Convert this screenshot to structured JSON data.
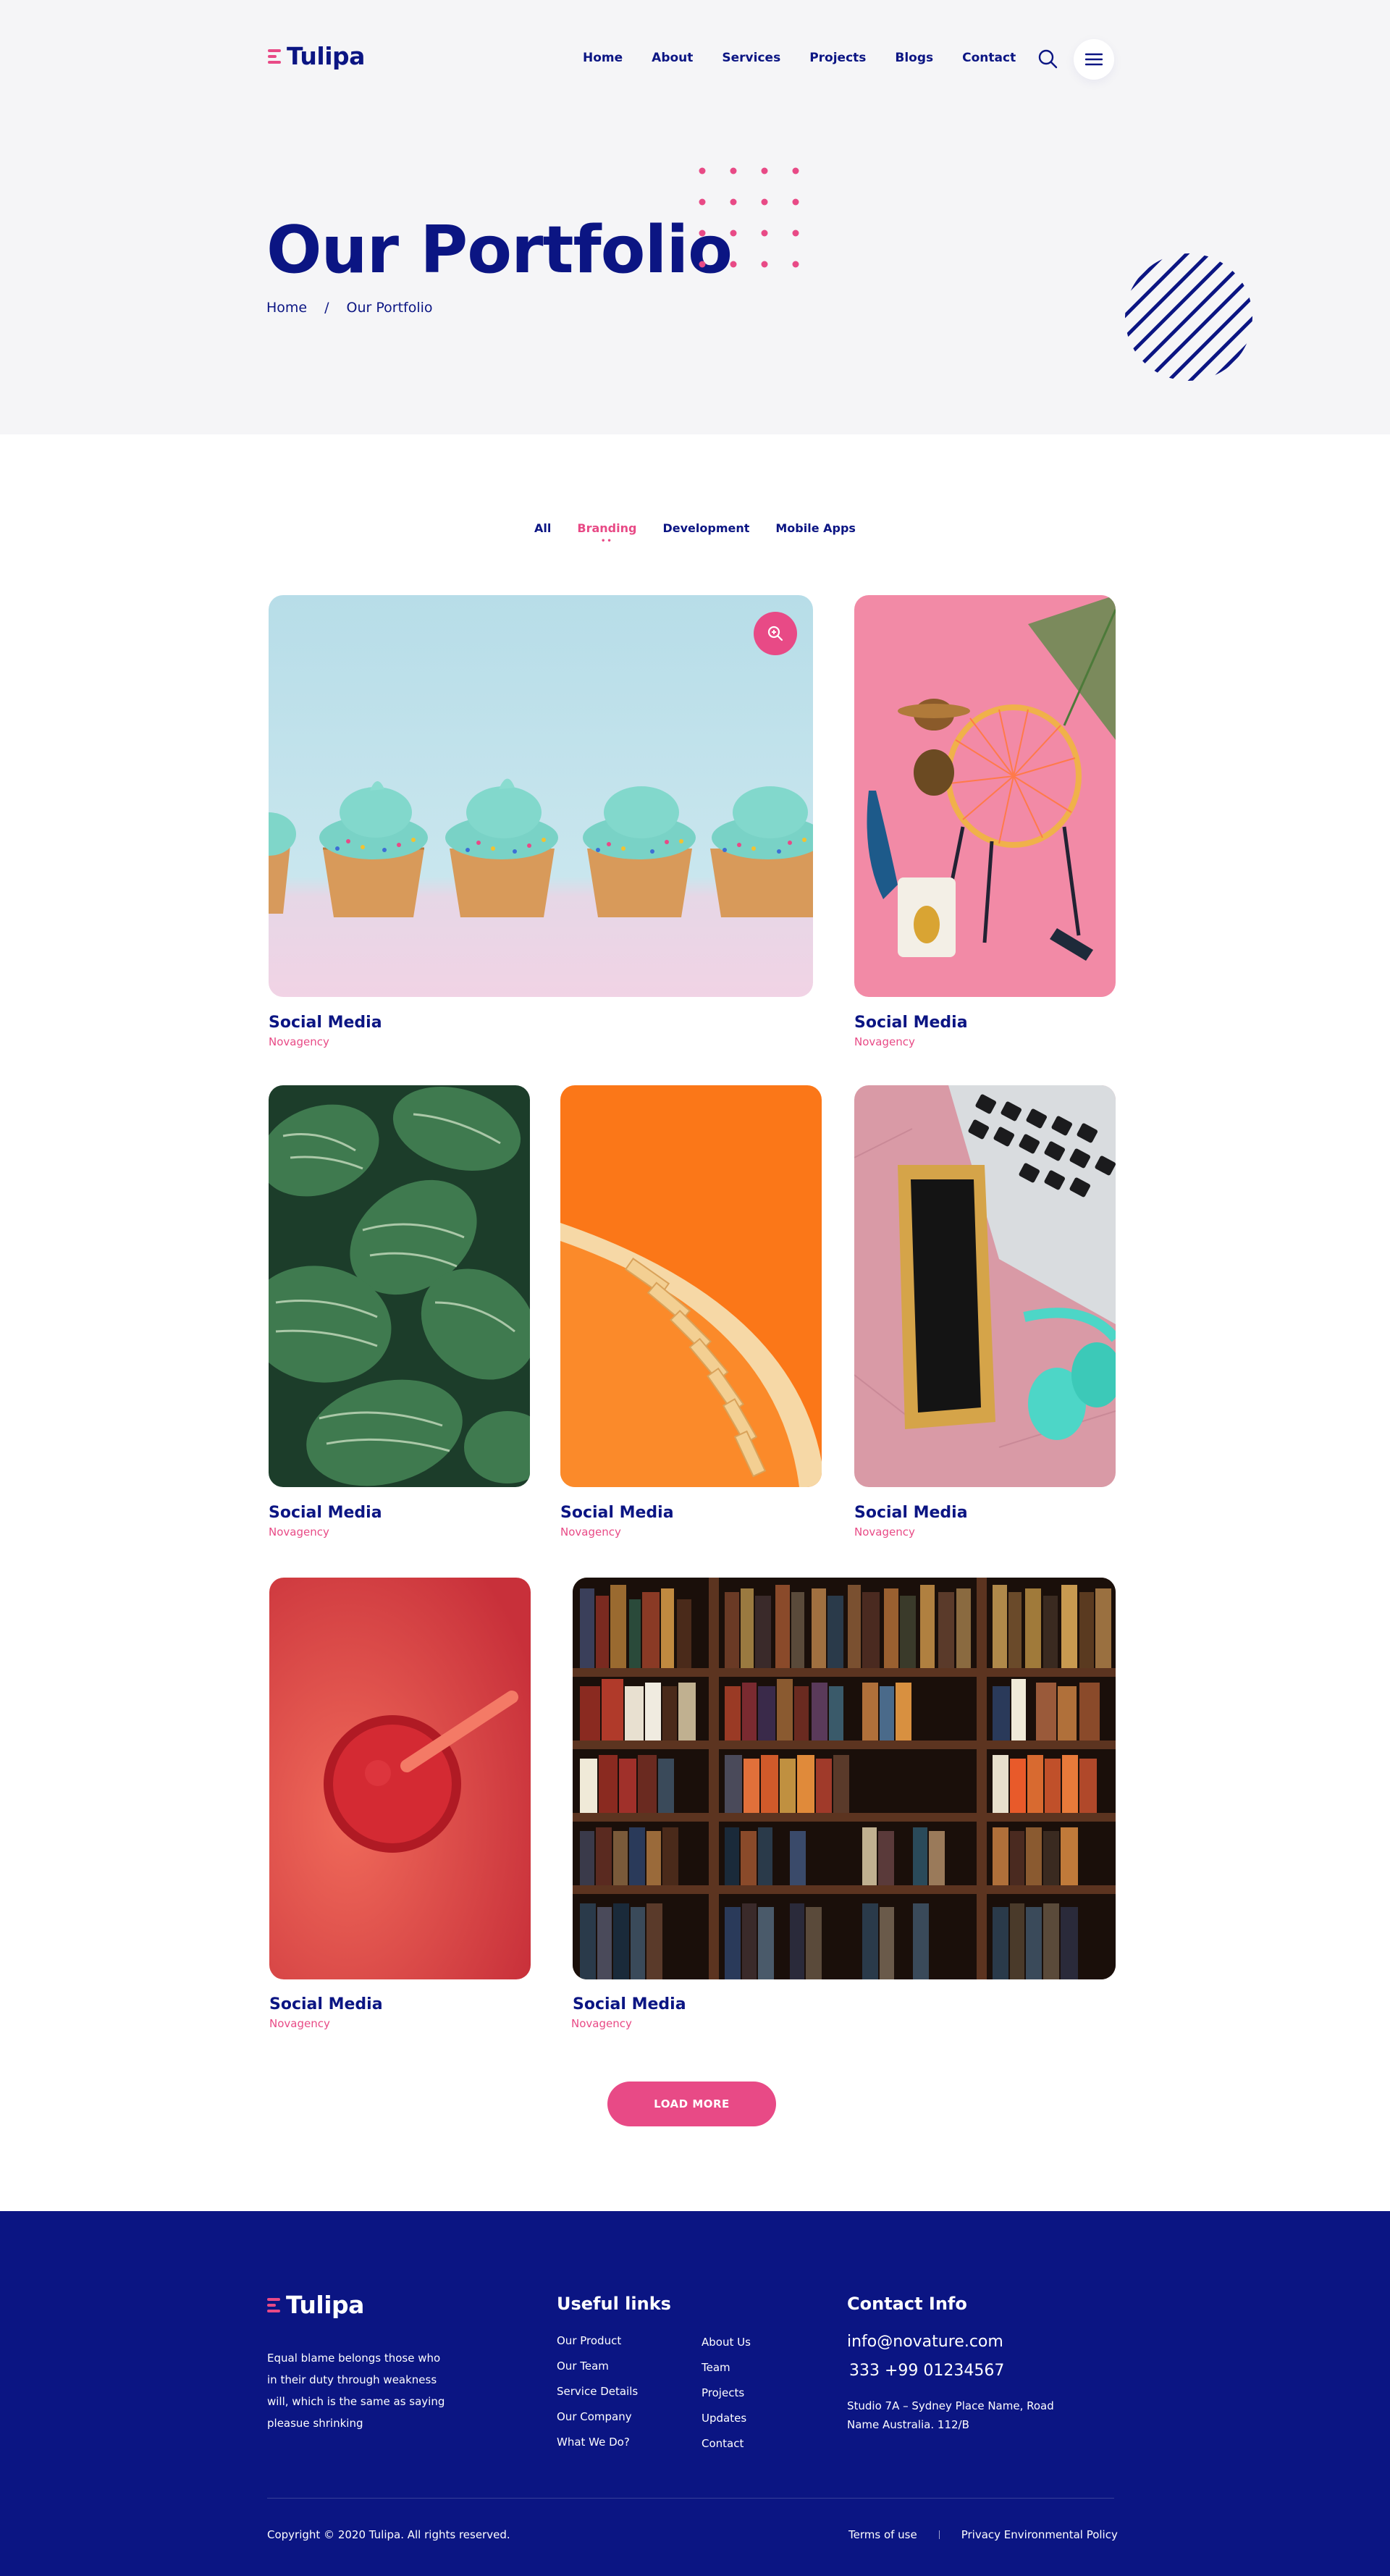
{
  "brand": {
    "name": "Tulipa",
    "accent_color": "#e84a86",
    "primary_color": "#0b1583"
  },
  "nav": {
    "items": [
      "Home",
      "About",
      "Services",
      "Projects",
      "Blogs",
      "Contact"
    ],
    "search_icon": "search-icon",
    "menu_icon": "hamburger-menu-icon"
  },
  "hero": {
    "title": "Our Portfolio",
    "breadcrumb": {
      "home": "Home",
      "separator": "/",
      "current": "Our Portfolio"
    }
  },
  "filters": {
    "items": [
      "All",
      "Branding",
      "Development",
      "Mobile Apps"
    ],
    "active": "Branding"
  },
  "portfolio": {
    "items": [
      {
        "title": "Social Media",
        "subtitle": "Novagency",
        "image": "cupcakes-photo"
      },
      {
        "title": "Social Media",
        "subtitle": "Novagency",
        "image": "pink-chair-photo"
      },
      {
        "title": "Social Media",
        "subtitle": "Novagency",
        "image": "striped-leaves-photo"
      },
      {
        "title": "Social Media",
        "subtitle": "Novagency",
        "image": "orange-staircase-photo"
      },
      {
        "title": "Social Media",
        "subtitle": "Novagency",
        "image": "laptop-headphones-photo"
      },
      {
        "title": "Social Media",
        "subtitle": "Novagency",
        "image": "red-smoothie-photo"
      },
      {
        "title": "Social Media",
        "subtitle": "Novagency",
        "image": "bookshelf-photo"
      }
    ],
    "zoom_icon": "zoom-in-icon",
    "load_more_label": "LOAD MORE"
  },
  "footer": {
    "about_text": "Equal blame belongs those who in their duty through weakness will, which is the same as saying pleasue shrinking",
    "useful_links_heading": "Useful links",
    "links_col1": [
      "Our Product",
      "Our Team",
      "Service Details",
      "Our Company",
      "What We Do?"
    ],
    "links_col2": [
      "About Us",
      "Team",
      "Projects",
      "Updates",
      "Contact"
    ],
    "contact_heading": "Contact Info",
    "email": "info@novature.com",
    "phone": "333 +99 01234567",
    "address": "Studio 7A – Sydney Place Name, Road Name Australia. 112/B",
    "copyright": "Copyright © 2020 Tulipa. All rights reserved.",
    "terms": "Terms of use",
    "privacy": "Privacy Environmental Policy"
  }
}
